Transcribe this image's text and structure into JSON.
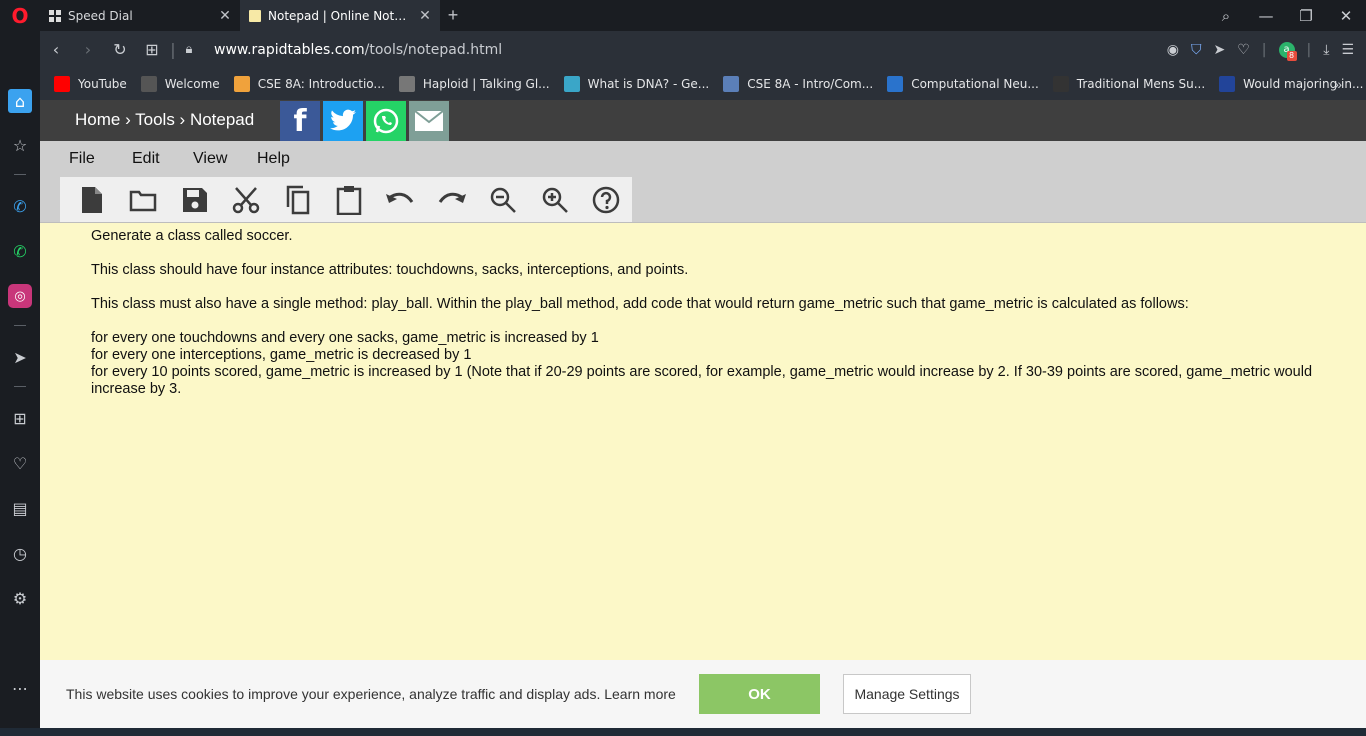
{
  "browser": {
    "tabs": [
      {
        "label": "Speed Dial",
        "icon": "speed-dial-icon",
        "active": false
      },
      {
        "label": "Notepad | Online Notes fre",
        "icon": "notepad-favicon",
        "active": true
      }
    ],
    "url_domain": "www.rapidtables.com",
    "url_path": "/tools/notepad.html",
    "bookmarks": [
      {
        "label": "YouTube",
        "icon": "youtube-icon",
        "color": "#ff0000"
      },
      {
        "label": "Welcome",
        "icon": "arrow-icon",
        "color": "#555555"
      },
      {
        "label": "CSE 8A: Introductio...",
        "icon": "zybooks-icon",
        "color": "#f0a23c"
      },
      {
        "label": "Haploid | Talking Gl...",
        "icon": "haploid-icon",
        "color": "#777777"
      },
      {
        "label": "What is DNA? - Ge...",
        "icon": "dna-icon",
        "color": "#3aa6c8"
      },
      {
        "label": "CSE 8A - Intro/Com...",
        "icon": "globe-icon",
        "color": "#5b7fb8"
      },
      {
        "label": "Computational Neu...",
        "icon": "coursera-icon",
        "color": "#2a73cc"
      },
      {
        "label": "Traditional Mens Su...",
        "icon": "hat-icon",
        "color": "#333333"
      },
      {
        "label": "Would majoring in...",
        "icon": "quora-icon",
        "color": "#224499"
      }
    ],
    "badge_count": "8"
  },
  "site": {
    "breadcrumb": "Home › Tools › Notepad",
    "social": [
      {
        "name": "facebook-button",
        "glyph": "f",
        "color": "#3b5998"
      },
      {
        "name": "twitter-button",
        "glyph": "t",
        "color": "#1da1f2"
      },
      {
        "name": "whatsapp-button",
        "glyph": "w",
        "color": "#25d366"
      },
      {
        "name": "email-button",
        "glyph": "✉",
        "color": "#7f9f97"
      }
    ],
    "menu": [
      "File",
      "Edit",
      "View",
      "Help"
    ]
  },
  "editor": {
    "lines": [
      "Generate a class called soccer.",
      "",
      "This class should have four instance attributes: touchdowns, sacks, interceptions, and points.",
      "",
      "This class must also have a single method: play_ball. Within the play_ball method, add code that would return game_metric such that game_metric is calculated as follows:",
      "",
      "for every one touchdowns and every one sacks, game_metric is increased by 1",
      "for every one interceptions, game_metric is decreased by 1",
      "for every 10 points scored, game_metric is increased by 1 (Note that if 20-29 points are scored, for example, game_metric would increase by 2. If 30-39 points are scored, game_metric would increase by 3."
    ]
  },
  "cookie": {
    "text": "This website uses cookies to improve your experience, analyze traffic and display ads. Learn more",
    "ok_label": "OK",
    "manage_label": "Manage Settings"
  }
}
